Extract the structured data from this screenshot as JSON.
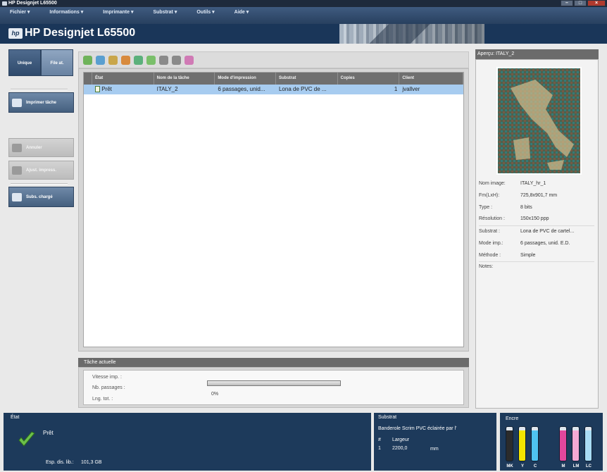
{
  "window": {
    "title": "HP Designjet L65500"
  },
  "menu": [
    "Fichier ▾",
    "Informations ▾",
    "Imprimante ▾",
    "Substrat ▾",
    "Outils ▾",
    "Aide ▾"
  ],
  "banner": {
    "logo": "hp",
    "title": "HP Designjet L65500"
  },
  "left_panel": {
    "tab_unique": "Unique",
    "tab_queue": "File at.",
    "print_job": "Imprimer tâche",
    "cancel": "Annuler",
    "adjust_print": "Ajust. impress.",
    "substrate_loaded": "Subs. chargé"
  },
  "toolbar_icons": [
    "add-job-icon",
    "add-folder-icon",
    "edit-icon",
    "users-icon",
    "copy-icon",
    "paste-icon",
    "up-arrow-icon",
    "down-arrow-icon",
    "settings-icon"
  ],
  "table": {
    "columns": [
      "État",
      "Nom de la tâche",
      "Mode d'impression",
      "Substrat",
      "Copies",
      "Client"
    ],
    "rows": [
      {
        "state": "Prêt",
        "name": "ITALY_2",
        "mode": "6 passages, unid...",
        "substrate": "Lona de PVC de ...",
        "copies": "1",
        "client": "jvallver"
      }
    ]
  },
  "current_job": {
    "header": "Tâche actuelle",
    "speed_label": "Vitesse imp. :",
    "passes_label": "Nb. passages :",
    "length_label": "Lng. tot. :",
    "progress_text": "0%",
    "progress": 0
  },
  "preview": {
    "header": "Aperçu: ITALY_2",
    "fields": [
      {
        "label": "Nom image:",
        "value": "ITALY_hr_1"
      },
      {
        "label": "Fm(LxH):",
        "value": "725,8x901,7 mm"
      },
      {
        "label": "Type :",
        "value": "8 bits"
      },
      {
        "label": "Résolution :",
        "value": "150x150 ppp"
      },
      {
        "label": "Substrat :",
        "value": "Lona de PVC de cartel..."
      },
      {
        "label": "Mode imp.:",
        "value": "6 passages, unid. E.D."
      },
      {
        "label": "Méthode :",
        "value": "Simple"
      },
      {
        "label": "Notes:",
        "value": ""
      }
    ]
  },
  "status": {
    "header": "État",
    "state": "Prêt",
    "free_space_label": "Esp. dis. lib.:",
    "free_space": "101,3 GB"
  },
  "substrate_panel": {
    "header": "Substrat",
    "name": "Banderole Scrim PVC éclairée par l'",
    "col_hash": "#",
    "col_width": "Largeur",
    "row_num": "1",
    "row_width": "2200,0",
    "unit": "mm"
  },
  "ink": {
    "header": "Encre",
    "cartridges": [
      {
        "label": "MK",
        "color": "#2b2b2b",
        "level": 0.9
      },
      {
        "label": "Y",
        "color": "#f4e500",
        "level": 0.9
      },
      {
        "label": "C",
        "color": "#4fc3f0",
        "level": 0.9
      },
      {
        "label": "M",
        "color": "#e2479c",
        "level": 0.9
      },
      {
        "label": "LM",
        "color": "#f4a9d4",
        "level": 0.9
      },
      {
        "label": "LC",
        "color": "#a8dcf5",
        "level": 0.9
      }
    ]
  }
}
